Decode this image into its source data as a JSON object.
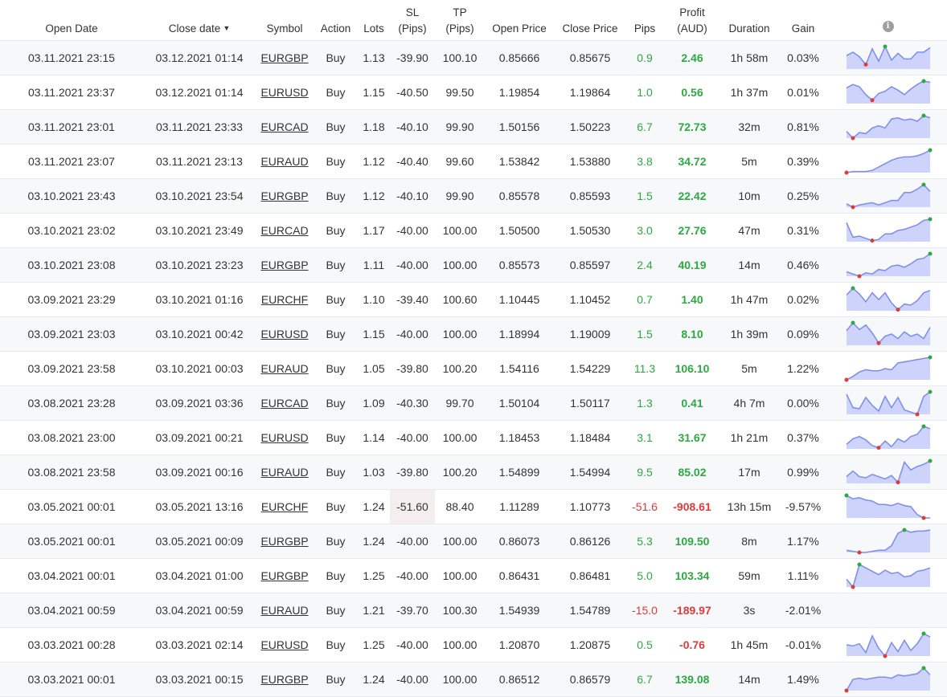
{
  "columns": {
    "open_date": "Open Date",
    "close_date": "Close date",
    "sort_glyph": "▼",
    "symbol": "Symbol",
    "action": "Action",
    "lots": "Lots",
    "sl_top": "SL",
    "sl_bottom": "(Pips)",
    "tp_top": "TP",
    "tp_bottom": "(Pips)",
    "open_price": "Open Price",
    "close_price": "Close Price",
    "pips": "Pips",
    "profit_top": "Profit",
    "profit_bottom": "(AUD)",
    "duration": "Duration",
    "gain": "Gain",
    "info_icon": "i"
  },
  "colors": {
    "positive": "#2ea843",
    "negative": "#e03a3a",
    "spark_line": "#7b8cf0",
    "spark_fill": "#cdd3fb",
    "spark_high": "#2ea843",
    "spark_low": "#e03a3a"
  },
  "rows": [
    {
      "open_date": "03.11.2021 23:15",
      "close_date": "03.12.2021 01:14",
      "symbol": "EURGBP",
      "action": "Buy",
      "lots": "1.13",
      "sl": "-39.90",
      "tp": "100.10",
      "open_price": "0.85666",
      "close_price": "0.85675",
      "pips": "0.9",
      "profit": "2.46",
      "duration": "1h 58m",
      "gain": "0.03%",
      "positive": true,
      "sl_hit": false,
      "spark": [
        0.6,
        0.75,
        0.55,
        0.2,
        0.9,
        0.35,
        1,
        0.4,
        0.7,
        0.45,
        0.45,
        0.75,
        0.75,
        0.95
      ]
    },
    {
      "open_date": "03.11.2021 23:37",
      "close_date": "03.12.2021 01:14",
      "symbol": "EURUSD",
      "action": "Buy",
      "lots": "1.15",
      "sl": "-40.50",
      "tp": "99.50",
      "open_price": "1.19854",
      "close_price": "1.19864",
      "pips": "1.0",
      "profit": "0.56",
      "duration": "1h 37m",
      "gain": "0.01%",
      "positive": true,
      "sl_hit": false,
      "spark": [
        0.7,
        0.85,
        0.75,
        0.4,
        0.15,
        0.45,
        0.55,
        0.75,
        0.6,
        0.4,
        0.65,
        0.85,
        1,
        0.95
      ]
    },
    {
      "open_date": "03.11.2021 23:01",
      "close_date": "03.11.2021 23:33",
      "symbol": "EURCAD",
      "action": "Buy",
      "lots": "1.18",
      "sl": "-40.10",
      "tp": "99.90",
      "open_price": "1.50156",
      "close_price": "1.50223",
      "pips": "6.7",
      "profit": "72.73",
      "duration": "32m",
      "gain": "0.81%",
      "positive": true,
      "sl_hit": false,
      "spark": [
        0.3,
        0,
        0.25,
        0.2,
        0.45,
        0.55,
        0.45,
        0.85,
        0.9,
        0.8,
        0.85,
        0.75,
        1,
        0.9
      ]
    },
    {
      "open_date": "03.11.2021 23:07",
      "close_date": "03.11.2021 23:13",
      "symbol": "EURAUD",
      "action": "Buy",
      "lots": "1.12",
      "sl": "-40.40",
      "tp": "99.60",
      "open_price": "1.53842",
      "close_price": "1.53880",
      "pips": "3.8",
      "profit": "34.72",
      "duration": "5m",
      "gain": "0.39%",
      "positive": true,
      "sl_hit": false,
      "spark": [
        0,
        0.05,
        0.05,
        0.05,
        0.1,
        0.25,
        0.4,
        0.55,
        0.65,
        0.7,
        0.7,
        0.75,
        0.85,
        1
      ]
    },
    {
      "open_date": "03.10.2021 23:43",
      "close_date": "03.10.2021 23:54",
      "symbol": "EURGBP",
      "action": "Buy",
      "lots": "1.12",
      "sl": "-40.10",
      "tp": "99.90",
      "open_price": "0.85578",
      "close_price": "0.85593",
      "pips": "1.5",
      "profit": "22.42",
      "duration": "10m",
      "gain": "0.25%",
      "positive": true,
      "sl_hit": false,
      "spark": [
        0.15,
        0,
        0.1,
        0.15,
        0.2,
        0.1,
        0.2,
        0.3,
        0.3,
        0.65,
        0.65,
        0.8,
        1,
        0.7
      ]
    },
    {
      "open_date": "03.10.2021 23:02",
      "close_date": "03.10.2021 23:49",
      "symbol": "EURCAD",
      "action": "Buy",
      "lots": "1.17",
      "sl": "-40.00",
      "tp": "100.00",
      "open_price": "1.50500",
      "close_price": "1.50530",
      "pips": "3.0",
      "profit": "27.76",
      "duration": "47m",
      "gain": "0.31%",
      "positive": true,
      "sl_hit": false,
      "spark": [
        0.85,
        0.2,
        0.25,
        0.15,
        0.05,
        0.1,
        0.35,
        0.35,
        0.5,
        0.55,
        0.65,
        0.75,
        0.95,
        1
      ]
    },
    {
      "open_date": "03.10.2021 23:08",
      "close_date": "03.10.2021 23:23",
      "symbol": "EURGBP",
      "action": "Buy",
      "lots": "1.11",
      "sl": "-40.00",
      "tp": "100.00",
      "open_price": "0.85573",
      "close_price": "0.85597",
      "pips": "2.4",
      "profit": "40.19",
      "duration": "14m",
      "gain": "0.46%",
      "positive": true,
      "sl_hit": false,
      "spark": [
        0.2,
        0.1,
        0,
        0.15,
        0.1,
        0.3,
        0.25,
        0.45,
        0.5,
        0.4,
        0.55,
        0.75,
        0.8,
        1
      ]
    },
    {
      "open_date": "03.09.2021 23:29",
      "close_date": "03.10.2021 01:16",
      "symbol": "EURCHF",
      "action": "Buy",
      "lots": "1.10",
      "sl": "-39.40",
      "tp": "100.60",
      "open_price": "1.10445",
      "close_price": "1.10452",
      "pips": "0.7",
      "profit": "1.40",
      "duration": "1h 47m",
      "gain": "0.02%",
      "positive": true,
      "sl_hit": false,
      "spark": [
        0.7,
        1,
        0.75,
        0.4,
        0.8,
        0.5,
        0.8,
        0.35,
        0.05,
        0.3,
        0.25,
        0.45,
        0.8,
        0.9
      ]
    },
    {
      "open_date": "03.09.2021 23:03",
      "close_date": "03.10.2021 00:42",
      "symbol": "EURUSD",
      "action": "Buy",
      "lots": "1.15",
      "sl": "-40.00",
      "tp": "100.00",
      "open_price": "1.18994",
      "close_price": "1.19009",
      "pips": "1.5",
      "profit": "8.10",
      "duration": "1h 39m",
      "gain": "0.09%",
      "positive": true,
      "sl_hit": false,
      "spark": [
        0.65,
        1,
        0.7,
        0.9,
        0.55,
        0.1,
        0.4,
        0.5,
        0.3,
        0.6,
        0.4,
        0.5,
        0.3,
        0.8
      ]
    },
    {
      "open_date": "03.09.2021 23:58",
      "close_date": "03.10.2021 00:03",
      "symbol": "EURAUD",
      "action": "Buy",
      "lots": "1.05",
      "sl": "-39.80",
      "tp": "100.20",
      "open_price": "1.54116",
      "close_price": "1.54229",
      "pips": "11.3",
      "profit": "106.10",
      "duration": "5m",
      "gain": "1.22%",
      "positive": true,
      "sl_hit": false,
      "spark": [
        0,
        0.15,
        0.35,
        0.45,
        0.4,
        0.4,
        0.5,
        0.45,
        0.75,
        0.8,
        0.85,
        0.9,
        0.95,
        1
      ]
    },
    {
      "open_date": "03.08.2021 23:28",
      "close_date": "03.09.2021 03:36",
      "symbol": "EURCAD",
      "action": "Buy",
      "lots": "1.09",
      "sl": "-40.30",
      "tp": "99.70",
      "open_price": "1.50104",
      "close_price": "1.50117",
      "pips": "1.3",
      "profit": "0.41",
      "duration": "4h 7m",
      "gain": "0.00%",
      "positive": true,
      "sl_hit": false,
      "spark": [
        0.9,
        0.3,
        0.25,
        0.75,
        0.4,
        0.15,
        0.8,
        0.3,
        0.75,
        0.2,
        0.1,
        0,
        0.8,
        1
      ]
    },
    {
      "open_date": "03.08.2021 23:00",
      "close_date": "03.09.2021 00:21",
      "symbol": "EURUSD",
      "action": "Buy",
      "lots": "1.14",
      "sl": "-40.00",
      "tp": "100.00",
      "open_price": "1.18453",
      "close_price": "1.18484",
      "pips": "3.1",
      "profit": "31.67",
      "duration": "1h 21m",
      "gain": "0.37%",
      "positive": true,
      "sl_hit": false,
      "spark": [
        0.2,
        0.45,
        0.55,
        0.4,
        0.15,
        0.05,
        0.35,
        0.1,
        0.45,
        0.3,
        0.55,
        0.65,
        1,
        0.9
      ]
    },
    {
      "open_date": "03.08.2021 23:58",
      "close_date": "03.09.2021 00:16",
      "symbol": "EURAUD",
      "action": "Buy",
      "lots": "1.03",
      "sl": "-39.80",
      "tp": "100.20",
      "open_price": "1.54899",
      "close_price": "1.54994",
      "pips": "9.5",
      "profit": "85.02",
      "duration": "17m",
      "gain": "0.99%",
      "positive": true,
      "sl_hit": false,
      "spark": [
        0.3,
        0.55,
        0.3,
        0.25,
        0.4,
        0.3,
        0.2,
        0.35,
        0.05,
        0.95,
        0.6,
        0.75,
        0.85,
        1
      ]
    },
    {
      "open_date": "03.05.2021 00:01",
      "close_date": "03.05.2021 13:16",
      "symbol": "EURCHF",
      "action": "Buy",
      "lots": "1.24",
      "sl": "-51.60",
      "tp": "88.40",
      "open_price": "1.11289",
      "close_price": "1.10773",
      "pips": "-51.6",
      "profit": "-908.61",
      "duration": "13h 15m",
      "gain": "-9.57%",
      "positive": false,
      "sl_hit": true,
      "spark": [
        1,
        0.85,
        0.9,
        0.8,
        0.75,
        0.6,
        0.6,
        0.55,
        0.65,
        0.55,
        0.5,
        0.15,
        0,
        0
      ]
    },
    {
      "open_date": "03.05.2021 00:01",
      "close_date": "03.05.2021 00:09",
      "symbol": "EURGBP",
      "action": "Buy",
      "lots": "1.24",
      "sl": "-40.00",
      "tp": "100.00",
      "open_price": "0.86073",
      "close_price": "0.86126",
      "pips": "5.3",
      "profit": "109.50",
      "duration": "8m",
      "gain": "1.17%",
      "positive": true,
      "sl_hit": false,
      "spark": [
        0.1,
        0.05,
        0,
        0,
        0.05,
        0.1,
        0.1,
        0.3,
        0.85,
        1,
        0.9,
        0.95,
        0.95,
        1
      ]
    },
    {
      "open_date": "03.04.2021 00:01",
      "close_date": "03.04.2021 01:00",
      "symbol": "EURGBP",
      "action": "Buy",
      "lots": "1.25",
      "sl": "-40.00",
      "tp": "100.00",
      "open_price": "0.86431",
      "close_price": "0.86481",
      "pips": "5.0",
      "profit": "103.34",
      "duration": "59m",
      "gain": "1.11%",
      "positive": true,
      "sl_hit": false,
      "spark": [
        0.35,
        0,
        1,
        0.85,
        0.7,
        0.55,
        0.75,
        0.6,
        0.65,
        0.45,
        0.5,
        0.7,
        0.75,
        0.85
      ]
    },
    {
      "open_date": "03.04.2021 00:59",
      "close_date": "03.04.2021 00:59",
      "symbol": "EURAUD",
      "action": "Buy",
      "lots": "1.21",
      "sl": "-39.70",
      "tp": "100.30",
      "open_price": "1.54939",
      "close_price": "1.54789",
      "pips": "-15.0",
      "profit": "-189.97",
      "duration": "3s",
      "gain": "-2.01%",
      "positive": false,
      "sl_hit": false,
      "spark": []
    },
    {
      "open_date": "03.03.2021 00:28",
      "close_date": "03.03.2021 02:14",
      "symbol": "EURUSD",
      "action": "Buy",
      "lots": "1.25",
      "sl": "-40.00",
      "tp": "100.00",
      "open_price": "1.20870",
      "close_price": "1.20875",
      "pips": "0.5",
      "profit": "-0.76",
      "duration": "1h 45m",
      "gain": "-0.01%",
      "positive": false,
      "sl_hit": false,
      "spark": [
        0.5,
        0.45,
        0.55,
        0.15,
        0.9,
        0.35,
        0,
        0.6,
        0.2,
        0.7,
        0.25,
        0.55,
        1,
        0.85
      ]
    },
    {
      "open_date": "03.03.2021 00:01",
      "close_date": "03.03.2021 00:15",
      "symbol": "EURGBP",
      "action": "Buy",
      "lots": "1.24",
      "sl": "-40.00",
      "tp": "100.00",
      "open_price": "0.86512",
      "close_price": "0.86579",
      "pips": "6.7",
      "profit": "139.08",
      "duration": "14m",
      "gain": "1.49%",
      "positive": true,
      "sl_hit": false,
      "spark": [
        0,
        0.5,
        0.55,
        0.5,
        0.55,
        0.6,
        0.6,
        0.55,
        0.7,
        0.65,
        0.7,
        0.75,
        1,
        0.7
      ]
    }
  ]
}
